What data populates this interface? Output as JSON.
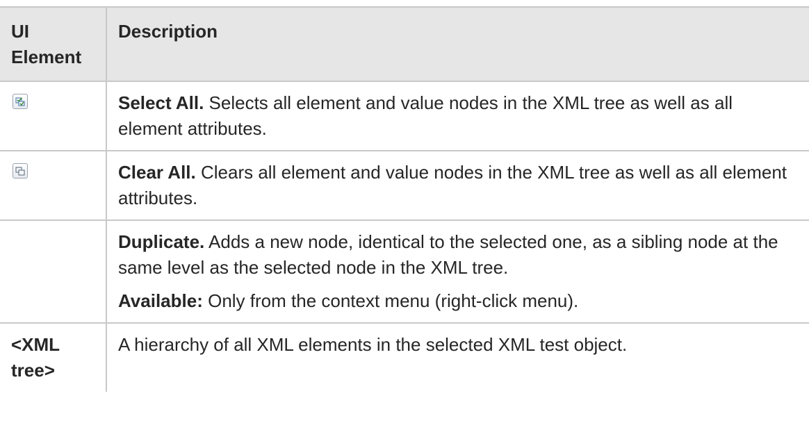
{
  "header": {
    "col1": "UI Element",
    "col2": "Description"
  },
  "rows": [
    {
      "icon": "select-all-icon",
      "term": "Select All.",
      "text": " Selects all element and value nodes in the XML tree as well as all element attributes."
    },
    {
      "icon": "clear-all-icon",
      "term": "Clear All.",
      "text": " Clears all element and value nodes in the XML tree as well as all element attributes."
    },
    {
      "icon": "",
      "term": "Duplicate.",
      "text": " Adds a new node, identical to the selected one, as a sibling node at the same level as the selected node in the XML tree.",
      "note_term": "Available:",
      "note_text": " Only from the context menu (right-click menu)."
    },
    {
      "element": "<XML tree>",
      "text": "A hierarchy of all XML elements in the selected XML test object."
    }
  ]
}
